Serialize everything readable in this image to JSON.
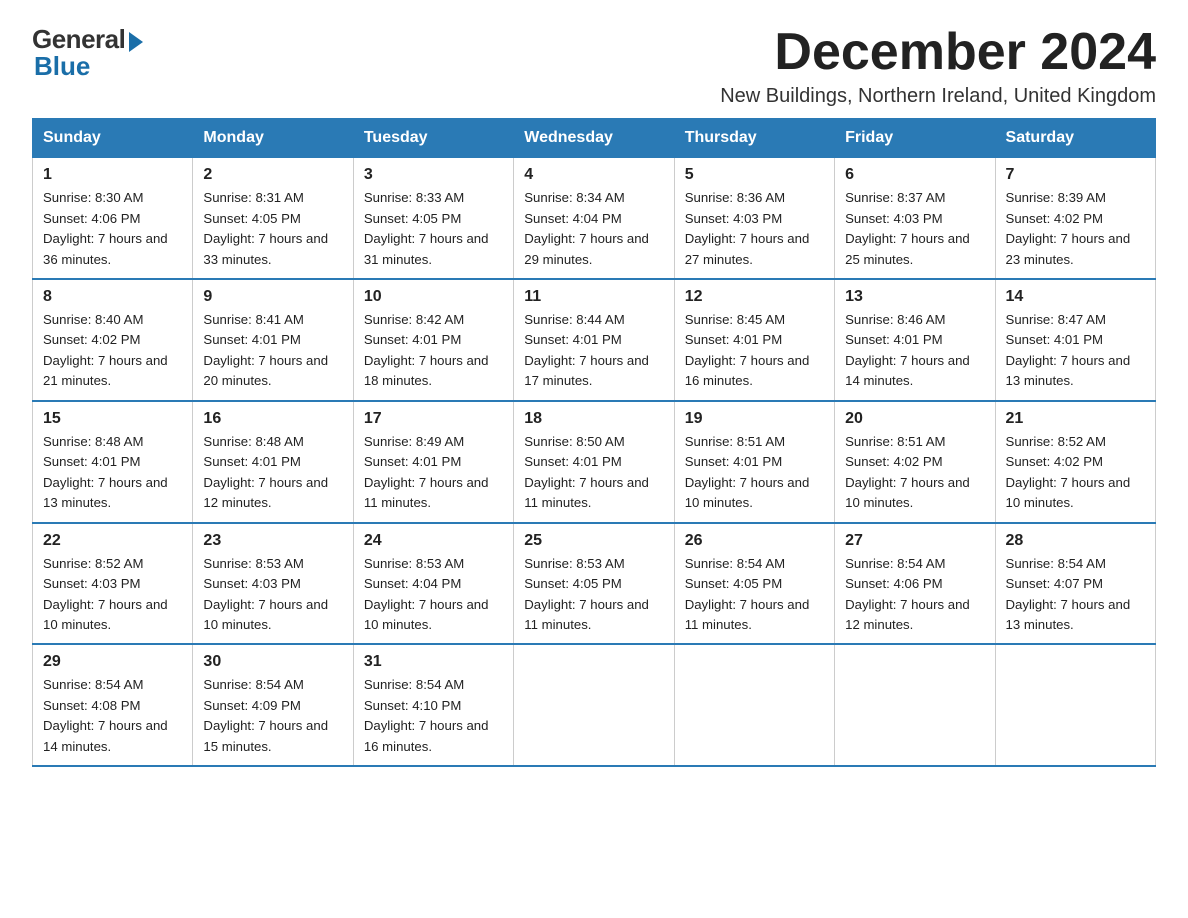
{
  "logo": {
    "general": "General",
    "blue": "Blue"
  },
  "title": "December 2024",
  "subtitle": "New Buildings, Northern Ireland, United Kingdom",
  "days_of_week": [
    "Sunday",
    "Monday",
    "Tuesday",
    "Wednesday",
    "Thursday",
    "Friday",
    "Saturday"
  ],
  "weeks": [
    [
      {
        "day": "1",
        "sunrise": "Sunrise: 8:30 AM",
        "sunset": "Sunset: 4:06 PM",
        "daylight": "Daylight: 7 hours and 36 minutes."
      },
      {
        "day": "2",
        "sunrise": "Sunrise: 8:31 AM",
        "sunset": "Sunset: 4:05 PM",
        "daylight": "Daylight: 7 hours and 33 minutes."
      },
      {
        "day": "3",
        "sunrise": "Sunrise: 8:33 AM",
        "sunset": "Sunset: 4:05 PM",
        "daylight": "Daylight: 7 hours and 31 minutes."
      },
      {
        "day": "4",
        "sunrise": "Sunrise: 8:34 AM",
        "sunset": "Sunset: 4:04 PM",
        "daylight": "Daylight: 7 hours and 29 minutes."
      },
      {
        "day": "5",
        "sunrise": "Sunrise: 8:36 AM",
        "sunset": "Sunset: 4:03 PM",
        "daylight": "Daylight: 7 hours and 27 minutes."
      },
      {
        "day": "6",
        "sunrise": "Sunrise: 8:37 AM",
        "sunset": "Sunset: 4:03 PM",
        "daylight": "Daylight: 7 hours and 25 minutes."
      },
      {
        "day": "7",
        "sunrise": "Sunrise: 8:39 AM",
        "sunset": "Sunset: 4:02 PM",
        "daylight": "Daylight: 7 hours and 23 minutes."
      }
    ],
    [
      {
        "day": "8",
        "sunrise": "Sunrise: 8:40 AM",
        "sunset": "Sunset: 4:02 PM",
        "daylight": "Daylight: 7 hours and 21 minutes."
      },
      {
        "day": "9",
        "sunrise": "Sunrise: 8:41 AM",
        "sunset": "Sunset: 4:01 PM",
        "daylight": "Daylight: 7 hours and 20 minutes."
      },
      {
        "day": "10",
        "sunrise": "Sunrise: 8:42 AM",
        "sunset": "Sunset: 4:01 PM",
        "daylight": "Daylight: 7 hours and 18 minutes."
      },
      {
        "day": "11",
        "sunrise": "Sunrise: 8:44 AM",
        "sunset": "Sunset: 4:01 PM",
        "daylight": "Daylight: 7 hours and 17 minutes."
      },
      {
        "day": "12",
        "sunrise": "Sunrise: 8:45 AM",
        "sunset": "Sunset: 4:01 PM",
        "daylight": "Daylight: 7 hours and 16 minutes."
      },
      {
        "day": "13",
        "sunrise": "Sunrise: 8:46 AM",
        "sunset": "Sunset: 4:01 PM",
        "daylight": "Daylight: 7 hours and 14 minutes."
      },
      {
        "day": "14",
        "sunrise": "Sunrise: 8:47 AM",
        "sunset": "Sunset: 4:01 PM",
        "daylight": "Daylight: 7 hours and 13 minutes."
      }
    ],
    [
      {
        "day": "15",
        "sunrise": "Sunrise: 8:48 AM",
        "sunset": "Sunset: 4:01 PM",
        "daylight": "Daylight: 7 hours and 13 minutes."
      },
      {
        "day": "16",
        "sunrise": "Sunrise: 8:48 AM",
        "sunset": "Sunset: 4:01 PM",
        "daylight": "Daylight: 7 hours and 12 minutes."
      },
      {
        "day": "17",
        "sunrise": "Sunrise: 8:49 AM",
        "sunset": "Sunset: 4:01 PM",
        "daylight": "Daylight: 7 hours and 11 minutes."
      },
      {
        "day": "18",
        "sunrise": "Sunrise: 8:50 AM",
        "sunset": "Sunset: 4:01 PM",
        "daylight": "Daylight: 7 hours and 11 minutes."
      },
      {
        "day": "19",
        "sunrise": "Sunrise: 8:51 AM",
        "sunset": "Sunset: 4:01 PM",
        "daylight": "Daylight: 7 hours and 10 minutes."
      },
      {
        "day": "20",
        "sunrise": "Sunrise: 8:51 AM",
        "sunset": "Sunset: 4:02 PM",
        "daylight": "Daylight: 7 hours and 10 minutes."
      },
      {
        "day": "21",
        "sunrise": "Sunrise: 8:52 AM",
        "sunset": "Sunset: 4:02 PM",
        "daylight": "Daylight: 7 hours and 10 minutes."
      }
    ],
    [
      {
        "day": "22",
        "sunrise": "Sunrise: 8:52 AM",
        "sunset": "Sunset: 4:03 PM",
        "daylight": "Daylight: 7 hours and 10 minutes."
      },
      {
        "day": "23",
        "sunrise": "Sunrise: 8:53 AM",
        "sunset": "Sunset: 4:03 PM",
        "daylight": "Daylight: 7 hours and 10 minutes."
      },
      {
        "day": "24",
        "sunrise": "Sunrise: 8:53 AM",
        "sunset": "Sunset: 4:04 PM",
        "daylight": "Daylight: 7 hours and 10 minutes."
      },
      {
        "day": "25",
        "sunrise": "Sunrise: 8:53 AM",
        "sunset": "Sunset: 4:05 PM",
        "daylight": "Daylight: 7 hours and 11 minutes."
      },
      {
        "day": "26",
        "sunrise": "Sunrise: 8:54 AM",
        "sunset": "Sunset: 4:05 PM",
        "daylight": "Daylight: 7 hours and 11 minutes."
      },
      {
        "day": "27",
        "sunrise": "Sunrise: 8:54 AM",
        "sunset": "Sunset: 4:06 PM",
        "daylight": "Daylight: 7 hours and 12 minutes."
      },
      {
        "day": "28",
        "sunrise": "Sunrise: 8:54 AM",
        "sunset": "Sunset: 4:07 PM",
        "daylight": "Daylight: 7 hours and 13 minutes."
      }
    ],
    [
      {
        "day": "29",
        "sunrise": "Sunrise: 8:54 AM",
        "sunset": "Sunset: 4:08 PM",
        "daylight": "Daylight: 7 hours and 14 minutes."
      },
      {
        "day": "30",
        "sunrise": "Sunrise: 8:54 AM",
        "sunset": "Sunset: 4:09 PM",
        "daylight": "Daylight: 7 hours and 15 minutes."
      },
      {
        "day": "31",
        "sunrise": "Sunrise: 8:54 AM",
        "sunset": "Sunset: 4:10 PM",
        "daylight": "Daylight: 7 hours and 16 minutes."
      },
      null,
      null,
      null,
      null
    ]
  ]
}
